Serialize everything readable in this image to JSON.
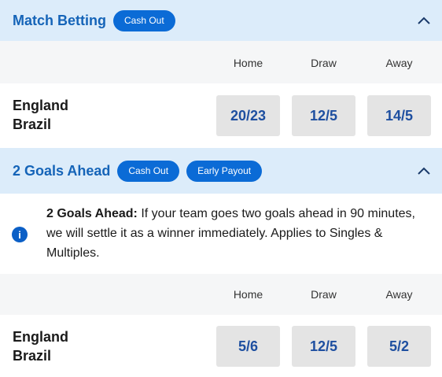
{
  "market1": {
    "title": "Match Betting",
    "badges": [
      "Cash Out"
    ],
    "columns": [
      "Home",
      "Draw",
      "Away"
    ],
    "team_home": "England",
    "team_away": "Brazil",
    "odds": [
      "20/23",
      "12/5",
      "14/5"
    ]
  },
  "market2": {
    "title": "2 Goals Ahead",
    "badges": [
      "Cash Out",
      "Early Payout"
    ],
    "info_title": "2 Goals Ahead:",
    "info_body": " If your team goes two goals ahead in 90 minutes, we will settle it as a winner immediately. Applies to Singles & Multiples.",
    "columns": [
      "Home",
      "Draw",
      "Away"
    ],
    "team_home": "England",
    "team_away": "Brazil",
    "odds": [
      "5/6",
      "12/5",
      "5/2"
    ]
  },
  "icons": {
    "collapse": "chevron-up-icon",
    "info": "info-icon",
    "info_glyph": "i"
  },
  "colors": {
    "accent": "#0b6bd6",
    "header_bg": "#dcecfa",
    "title": "#1564b8",
    "odds_text": "#1e4fa0"
  }
}
